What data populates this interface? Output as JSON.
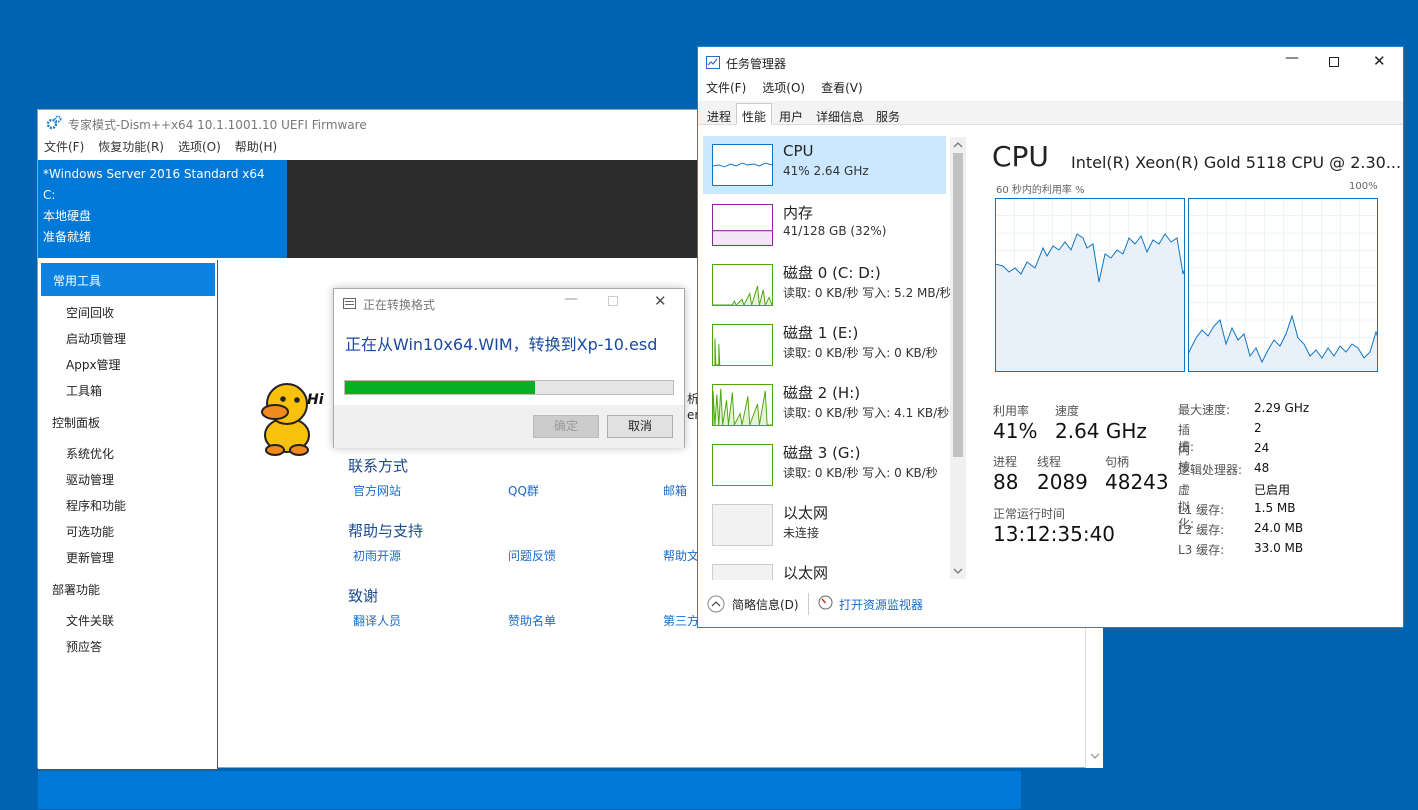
{
  "dism": {
    "title": "专家模式-Dism++x64 10.1.1001.10 UEFI Firmware",
    "menu": [
      "文件(F)",
      "恢复功能(R)",
      "选项(O)",
      "帮助(H)"
    ],
    "info": [
      "*Windows Server 2016 Standard x64",
      "C:",
      "本地硬盘",
      "准备就绪"
    ],
    "sidebar": {
      "selected": "常用工具",
      "group1": [
        "空间回收",
        "启动项管理",
        "Appx管理",
        "工具箱"
      ],
      "h2": "控制面板",
      "group2": [
        "系统优化",
        "驱动管理",
        "程序和功能",
        "可选功能",
        "更新管理"
      ],
      "h3": "部署功能",
      "group3": [
        "文件关联",
        "预应答"
      ]
    },
    "hi_text": "Hi",
    "partial_text": "析",
    "partial_text2": "er",
    "sections": [
      {
        "title": "联系方式",
        "links": [
          "官方网站",
          "QQ群",
          "邮箱"
        ]
      },
      {
        "title": "帮助与支持",
        "links": [
          "初雨开源",
          "问题反馈",
          "帮助文"
        ]
      },
      {
        "title": "致谢",
        "links": [
          "翻译人员",
          "赞助名单",
          "第三方"
        ]
      }
    ]
  },
  "dialog": {
    "title": "正在转换格式",
    "message": "正在从Win10x64.WIM，转换到Xp-10.esd",
    "progress": 0.58,
    "ok": "确定",
    "cancel": "取消"
  },
  "taskmgr": {
    "title": "任务管理器",
    "menu": [
      "文件(F)",
      "选项(O)",
      "查看(V)"
    ],
    "tabs": [
      "进程",
      "性能",
      "用户",
      "详细信息",
      "服务"
    ],
    "tiles": [
      {
        "name": "CPU",
        "sub": "41%  2.64 GHz"
      },
      {
        "name": "内存",
        "sub": "41/128 GB (32%)"
      },
      {
        "name": "磁盘 0 (C: D:)",
        "sub": "读取: 0 KB/秒  写入: 5.2 MB/秒"
      },
      {
        "name": "磁盘 1 (E:)",
        "sub": "读取: 0 KB/秒  写入: 0 KB/秒"
      },
      {
        "name": "磁盘 2 (H:)",
        "sub": "读取: 0 KB/秒  写入: 4.1 KB/秒"
      },
      {
        "name": "磁盘 3 (G:)",
        "sub": "读取: 0 KB/秒  写入: 0 KB/秒"
      },
      {
        "name": "以太网",
        "sub": "未连接"
      },
      {
        "name": "以太网",
        "sub": ""
      }
    ],
    "header": "CPU",
    "model": "Intel(R) Xeon(R) Gold 5118 CPU @ 2.30...",
    "graph_label": "60 秒内的利用率 %",
    "graph_max": "100%",
    "stats": {
      "util_label": "利用率",
      "util": "41%",
      "speed_label": "速度",
      "speed": "2.64 GHz",
      "proc_label": "进程",
      "proc": "88",
      "thread_label": "线程",
      "thread": "2089",
      "handle_label": "句柄",
      "handle": "48243",
      "uptime_label": "正常运行时间",
      "uptime": "13:12:35:40"
    },
    "right": [
      [
        "最大速度:",
        "2.29 GHz"
      ],
      [
        "插槽:",
        "2"
      ],
      [
        "内核:",
        "24"
      ],
      [
        "逻辑处理器:",
        "48"
      ],
      [
        "虚拟化:",
        "已启用"
      ],
      [
        "L1 缓存:",
        "1.5 MB"
      ],
      [
        "L2 缓存:",
        "24.0 MB"
      ],
      [
        "L3 缓存:",
        "33.0 MB"
      ]
    ],
    "footer_brief": "简略信息(D)",
    "footer_monitor": "打开资源监视器"
  },
  "colors": {
    "accent": "#0078d7",
    "progress": "#06b025",
    "cpu_graph": "#1174c2",
    "mem_graph": "#8e249e",
    "disk_graph": "#4da60c"
  }
}
